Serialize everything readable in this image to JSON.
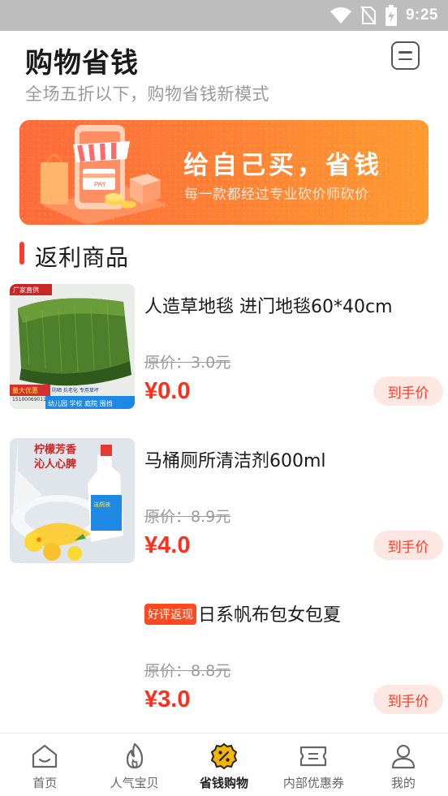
{
  "status_bar": {
    "time": "9:25"
  },
  "header": {
    "title": "购物省钱",
    "subtitle": "全场五折以下，购物省钱新模式"
  },
  "banner": {
    "title": "给自己买，省钱",
    "subtitle": "每一款都经过专业砍价师砍价",
    "illustration_text": "PAY"
  },
  "section": {
    "title": "返利商品"
  },
  "products": [
    {
      "name": "人造草地毯 进门地毯60*40cm",
      "tag": "",
      "original_price": "原价：3.0元",
      "price": "¥0.0",
      "button": "到手价",
      "image_text": [
        "厂家直供",
        "量大优惠",
        "防晒 抗老化 专用草坪",
        "15100069011",
        "幼儿园 学校 庭院 围挡"
      ]
    },
    {
      "name": "马桶厕所清洁剂600ml",
      "tag": "",
      "original_price": "原价：8.9元",
      "price": "¥4.0",
      "button": "到手价",
      "image_text": [
        "柠檬芳香",
        "沁人心脾"
      ]
    },
    {
      "name": "日系帆布包女包夏",
      "tag": "好评返现",
      "original_price": "原价：8.8元",
      "price": "¥3.0",
      "button": "到手价",
      "image_text": []
    }
  ],
  "tabs": [
    {
      "label": "首页",
      "icon": "home-icon",
      "active": false
    },
    {
      "label": "人气宝贝",
      "icon": "flame-icon",
      "active": false
    },
    {
      "label": "省钱购物",
      "icon": "discount-icon",
      "active": true
    },
    {
      "label": "内部优惠券",
      "icon": "coupon-icon",
      "active": false
    },
    {
      "label": "我的",
      "icon": "user-icon",
      "active": false
    }
  ],
  "colors": {
    "accent": "#ff3b30",
    "price": "#ff2e1e",
    "banner_start": "#ff6a3a",
    "banner_end": "#ff9a2f",
    "active_tab_icon": "#f5b400"
  }
}
